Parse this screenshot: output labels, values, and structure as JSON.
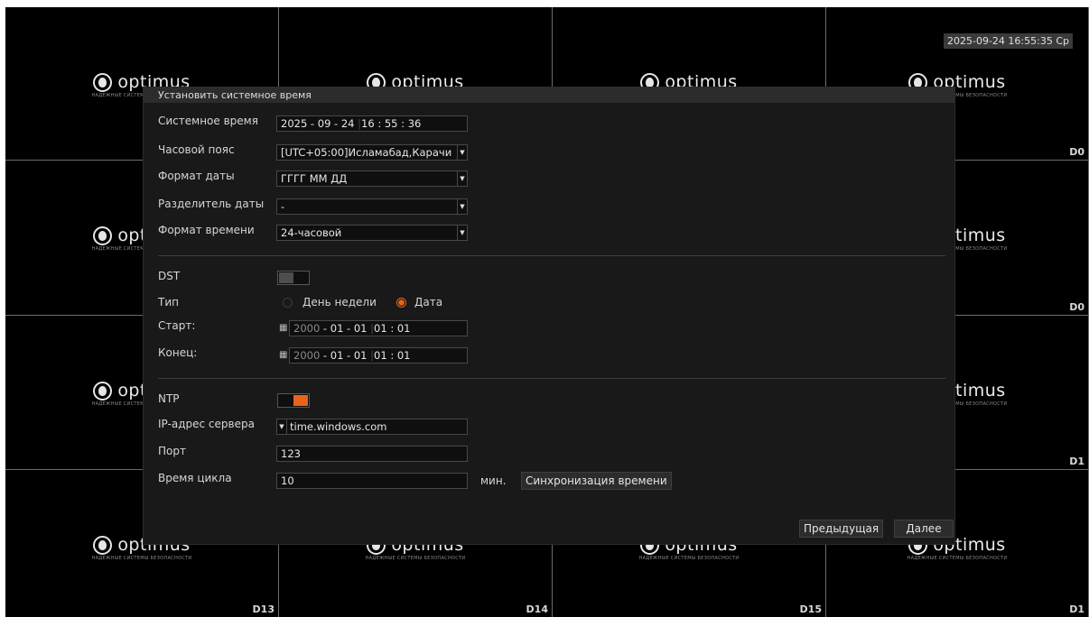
{
  "brand": {
    "name": "optimus",
    "tagline": "НАДЕЖНЫЕ СИСТЕМЫ БЕЗОПАСНОСТИ"
  },
  "clock": "2025-09-24 16:55:35 Ср",
  "channels": {
    "c4": "D0",
    "c8": "D0",
    "c12": "D1",
    "c13": "D13",
    "c14": "D14",
    "c15": "D15",
    "c16": "D1"
  },
  "dialog": {
    "title": "Установить системное время",
    "system_time": {
      "label": "Системное время",
      "year": "2025",
      "month": "09",
      "day": "24",
      "hour": "16",
      "minute": "55",
      "second": "36"
    },
    "timezone": {
      "label": "Часовой пояс",
      "value": "[UTC+05:00]Исламабад,Карачи"
    },
    "date_format": {
      "label": "Формат даты",
      "value": "ГГГГ ММ ДД"
    },
    "date_separator": {
      "label": "Разделитель даты",
      "value": "-"
    },
    "time_format": {
      "label": "Формат времени",
      "value": "24-часовой"
    },
    "dst": {
      "label": "DST",
      "enabled": false
    },
    "type": {
      "label": "Тип",
      "option_weekday": "День недели",
      "option_date": "Дата",
      "selected": "Дата"
    },
    "start": {
      "label": "Старт:",
      "year": "2000",
      "month": "01",
      "day": "01",
      "hour": "01",
      "minute": "01"
    },
    "end": {
      "label": "Конец:",
      "year": "2000",
      "month": "01",
      "day": "01",
      "hour": "01",
      "minute": "01"
    },
    "ntp": {
      "label": "NTP",
      "enabled": true
    },
    "server": {
      "label": "IP-адрес сервера",
      "value": "time.windows.com"
    },
    "port": {
      "label": "Порт",
      "value": "123"
    },
    "cycle": {
      "label": "Время цикла",
      "value": "10",
      "unit": "мин.",
      "sync_label": "Синхронизация времени"
    },
    "buttons": {
      "prev": "Предыдущая",
      "next": "Далее"
    }
  },
  "colors": {
    "accent": "#e8641c",
    "toggle_off": "#4e4e4e"
  }
}
